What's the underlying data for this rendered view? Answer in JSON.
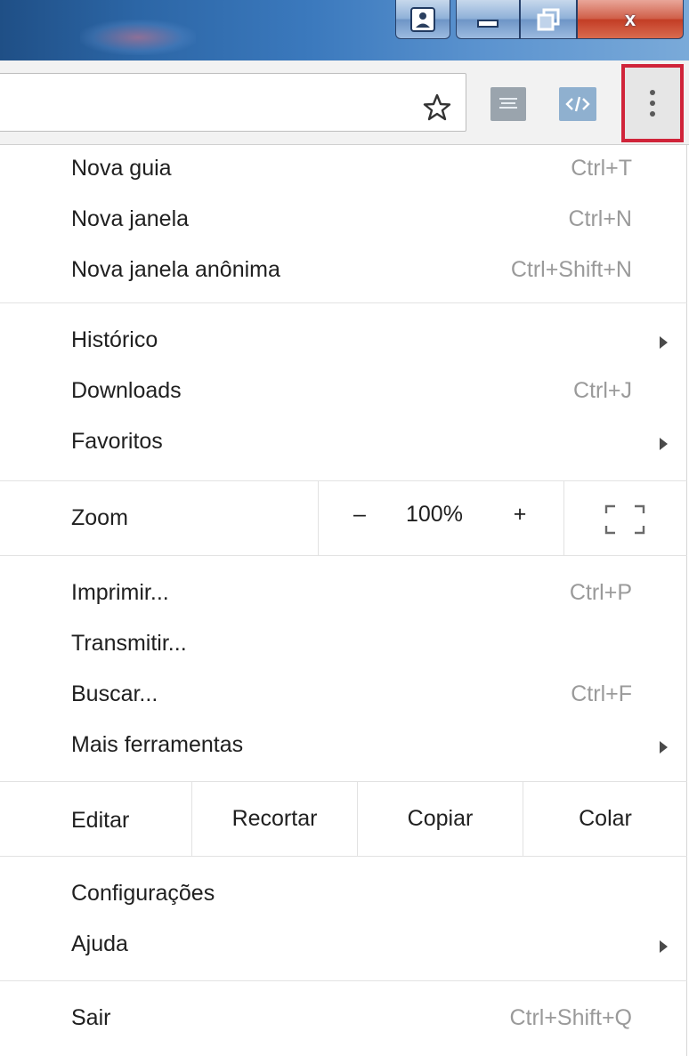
{
  "window": {
    "user_icon": "user-icon",
    "minimize_icon": "minimize-icon",
    "maximize_icon": "restore-icon",
    "close_label": "x"
  },
  "toolbar": {
    "bookmark_icon": "star-icon",
    "extension1_icon": "extension-icon",
    "extension2_icon": "code-icon",
    "menu_icon": "kebab-menu-icon",
    "highlight_color": "#d0243a"
  },
  "menu": {
    "group1": [
      {
        "label": "Nova guia",
        "shortcut": "Ctrl+T"
      },
      {
        "label": "Nova janela",
        "shortcut": "Ctrl+N"
      },
      {
        "label": "Nova janela anônima",
        "shortcut": "Ctrl+Shift+N"
      }
    ],
    "group2": [
      {
        "label": "Histórico",
        "shortcut": ""
      },
      {
        "label": "Downloads",
        "shortcut": "Ctrl+J"
      },
      {
        "label": "Favoritos",
        "shortcut": ""
      }
    ],
    "zoom": {
      "label": "Zoom",
      "minus": "–",
      "level": "100%",
      "plus": "+"
    },
    "group3": [
      {
        "label": "Imprimir...",
        "shortcut": "Ctrl+P"
      },
      {
        "label": "Transmitir...",
        "shortcut": ""
      },
      {
        "label": "Buscar...",
        "shortcut": "Ctrl+F"
      },
      {
        "label": "Mais ferramentas",
        "shortcut": ""
      }
    ],
    "edit": {
      "label": "Editar",
      "cut": "Recortar",
      "copy": "Copiar",
      "paste": "Colar"
    },
    "group4": [
      {
        "label": "Configurações",
        "shortcut": ""
      },
      {
        "label": "Ajuda",
        "shortcut": ""
      }
    ],
    "exit": {
      "label": "Sair",
      "shortcut": "Ctrl+Shift+Q"
    }
  }
}
